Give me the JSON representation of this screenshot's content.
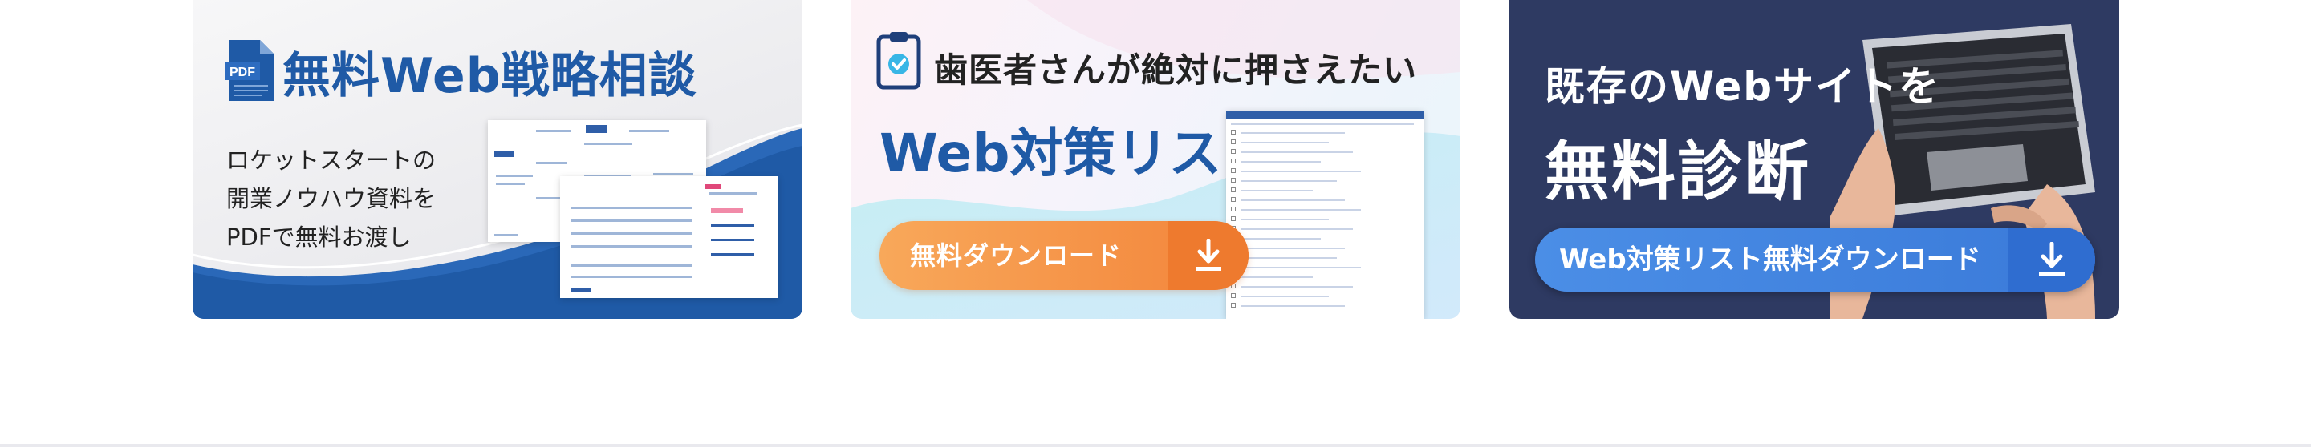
{
  "cards": {
    "consult": {
      "title": "無料Web戦略相談",
      "desc_line1": "ロケットスタートの",
      "desc_line2": "開業ノウハウ資料を",
      "desc_line3": "PDFで無料お渡し",
      "accent_color": "#1f5aa6"
    },
    "checklist": {
      "heading": "歯医者さんが絶対に押さえたい",
      "title": "Web対策リスト",
      "button_label": "無料ダウンロード",
      "button_color": "#f3843a"
    },
    "diagnosis": {
      "line1": "既存のWebサイトを",
      "line2": "無料診断",
      "button_label": "Web対策リスト無料ダウンロード",
      "button_color": "#3a7ad9",
      "background_color": "#2e3a62"
    }
  },
  "icons": {
    "pdf": "pdf-file-icon",
    "clipboard": "clipboard-check-icon",
    "download": "download-arrow-icon"
  }
}
